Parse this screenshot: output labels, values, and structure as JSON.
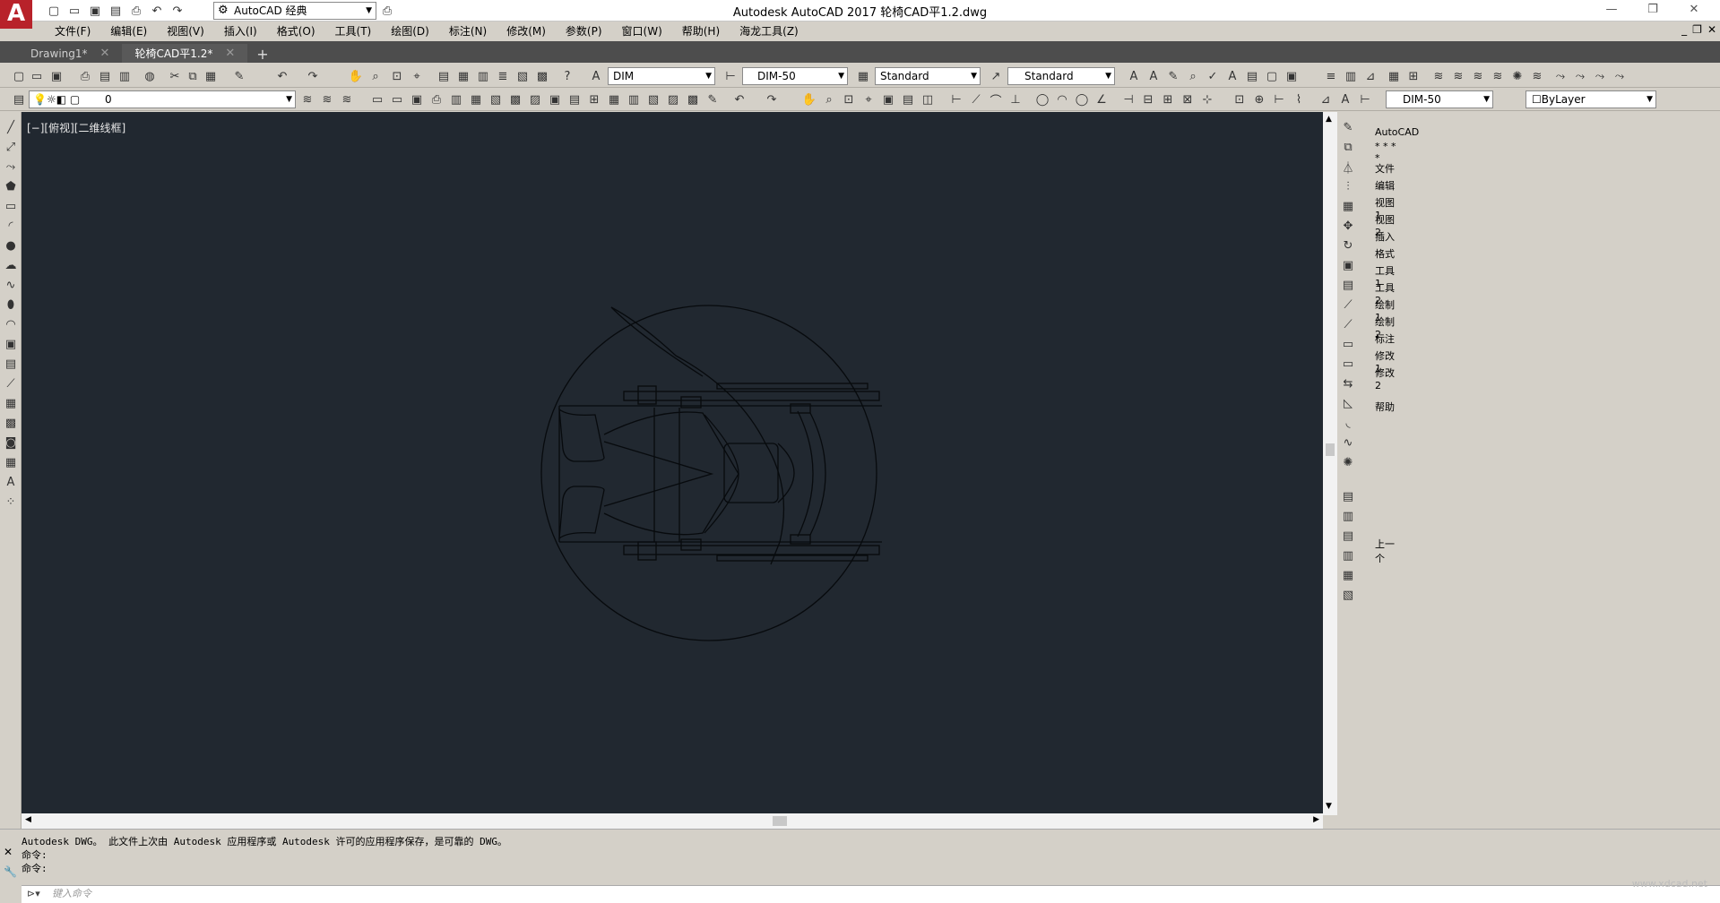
{
  "window": {
    "title": "Autodesk AutoCAD 2017    轮椅CAD平1.2.dwg",
    "logo": "A"
  },
  "workspace": {
    "value": "AutoCAD 经典"
  },
  "menu": [
    "文件(F)",
    "编辑(E)",
    "视图(V)",
    "插入(I)",
    "格式(O)",
    "工具(T)",
    "绘图(D)",
    "标注(N)",
    "修改(M)",
    "参数(P)",
    "窗口(W)",
    "帮助(H)",
    "海龙工具(Z)"
  ],
  "tabs": [
    {
      "label": "Drawing1*"
    },
    {
      "label": "轮椅CAD平1.2*"
    }
  ],
  "toolbar": {
    "dimstyle_left": "DIM",
    "dimstyle": "DIM-50",
    "textstyle": "Standard",
    "tablestyle": "Standard",
    "layer": "0",
    "dimstyle2": "DIM-50",
    "color": "ByLayer"
  },
  "canvas": {
    "view_label": "[−][俯视][二维线框]"
  },
  "right_panel": [
    "AutoCAD",
    "* * * *",
    "文件",
    "编辑",
    "视图 1",
    "视图 2",
    "插入",
    "格式",
    "工具 1",
    "工具 2",
    "绘制 1",
    "绘制 2",
    "标注",
    "修改 1",
    "修改 2",
    "帮助",
    "上一个"
  ],
  "command": {
    "history": [
      "Autodesk DWG。  此文件上次由 Autodesk 应用程序或 Autodesk 许可的应用程序保存，是可靠的 DWG。",
      "命令:",
      "命令:"
    ],
    "placeholder": "键入命令"
  },
  "watermark": "www.xdcad.net"
}
